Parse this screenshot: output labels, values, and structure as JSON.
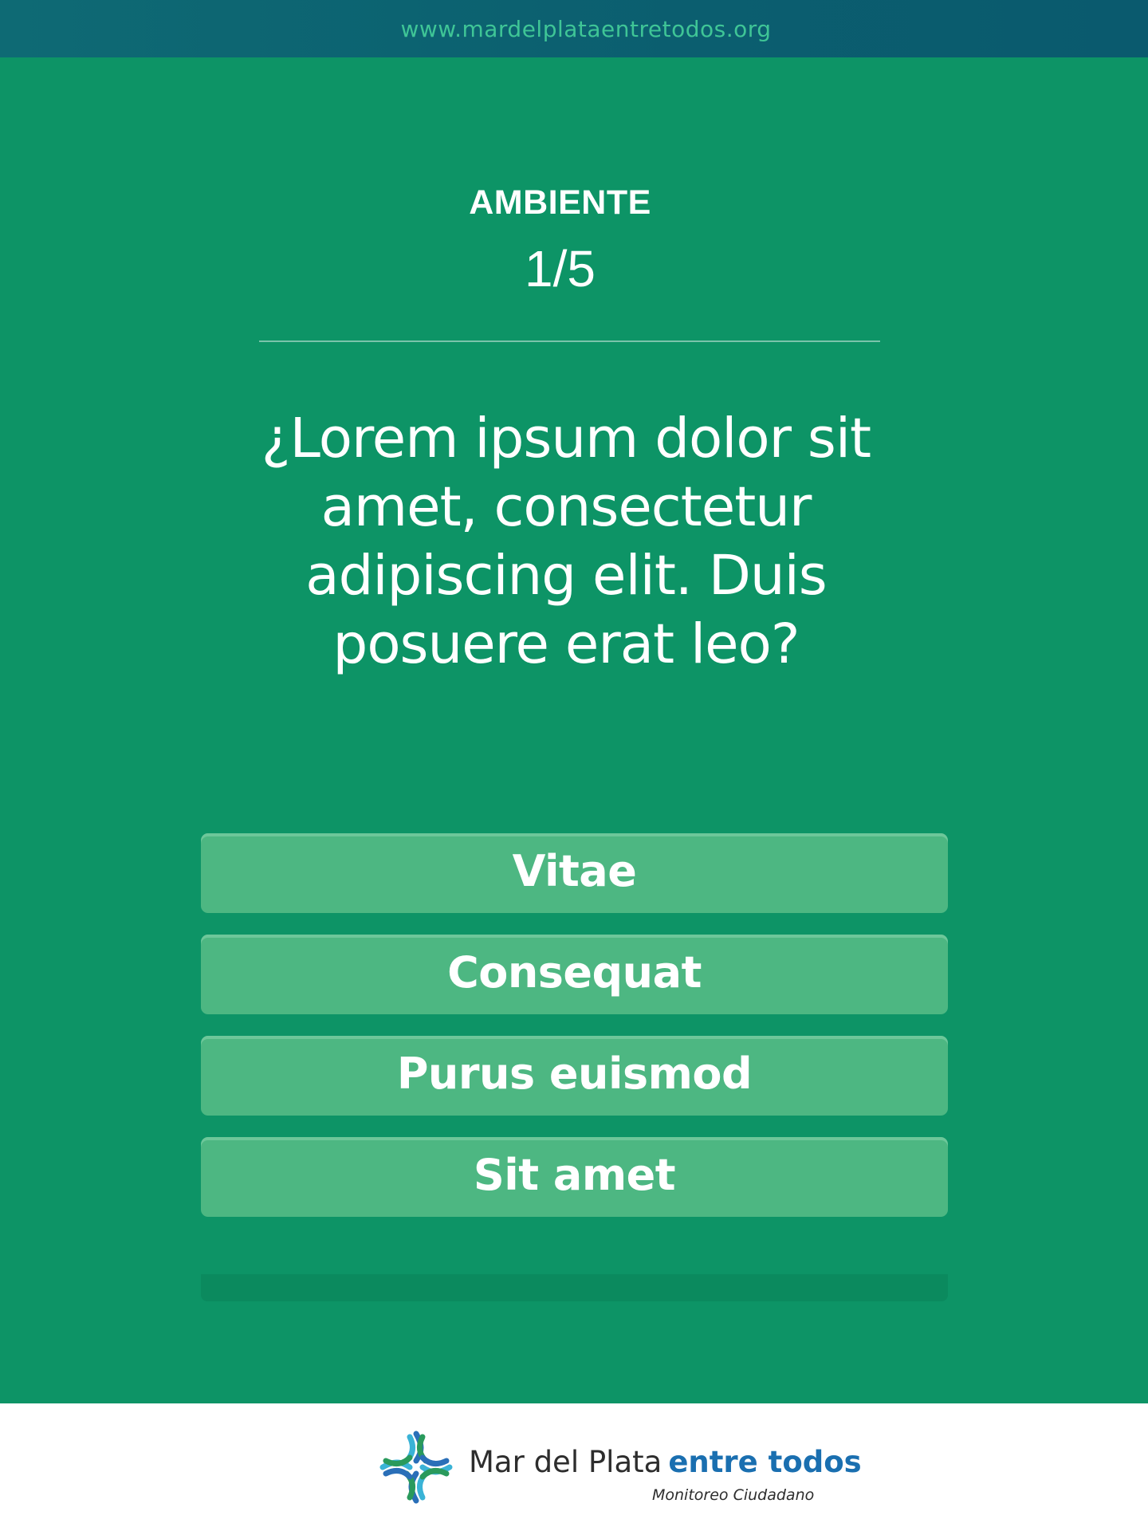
{
  "header": {
    "url": "www.mardelplataentretodos.org"
  },
  "quiz": {
    "category": "AMBIENTE",
    "progress": "1/5",
    "question": "¿Lorem ipsum dolor sit amet, consectetur adipiscing elit. Duis posuere erat leo?",
    "answers": [
      {
        "label": "Vitae"
      },
      {
        "label": "Consequat"
      },
      {
        "label": "Purus euismod"
      },
      {
        "label": "Sit amet"
      }
    ]
  },
  "footer": {
    "brand_name": "Mar del Plata",
    "brand_accent": "entre todos",
    "tagline": "Monitoreo Ciudadano",
    "logo_icon": "star-cross-logo-icon"
  },
  "colors": {
    "header_bg": "#0b5e6f",
    "url_text": "#3fc596",
    "main_bg": "#0d9466",
    "answer_bg": "#4db782",
    "brand_accent": "#1a6fb0"
  }
}
